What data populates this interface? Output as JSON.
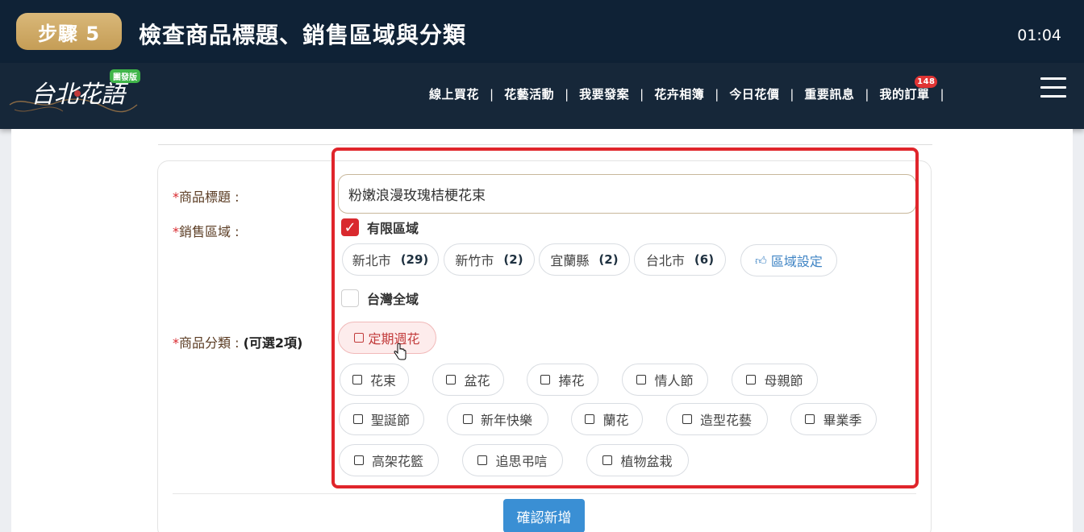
{
  "step": {
    "badge": "步驟 5",
    "title": "檢查商品標題、銷售區域與分類",
    "timer": "01:04"
  },
  "site": {
    "logo_text": "台北花語",
    "logo_badge": "團發版",
    "nav": [
      "線上買花",
      "花藝活動",
      "我要發案",
      "花卉相簿",
      "今日花價",
      "重要訊息",
      "我的訂單"
    ],
    "order_count": "148",
    "sep": "|"
  },
  "form": {
    "title_label": "商品標題 :",
    "region_label": "銷售區域 :",
    "category_label": "商品分類 :",
    "category_hint": "(可選2項)",
    "required_mark": "*",
    "title_value": "粉嫩浪漫玫瑰桔梗花束",
    "limited_region": "有限區域",
    "check_mark": "✓",
    "all_taiwan": "台灣全域",
    "regions": [
      {
        "name": "新北市",
        "count": "(29)"
      },
      {
        "name": "新竹市",
        "count": "(2)"
      },
      {
        "name": "宜蘭縣",
        "count": "(2)"
      },
      {
        "name": "台北市",
        "count": "(6)"
      }
    ],
    "region_settings": "區域設定",
    "selected_category": "定期週花",
    "categories": [
      "花束",
      "盆花",
      "捧花",
      "情人節",
      "母親節",
      "聖誕節",
      "新年快樂",
      "蘭花",
      "造型花藝",
      "畢業季",
      "高架花籃",
      "追思弔唁",
      "植物盆栽"
    ],
    "confirm_button": "確認新增"
  },
  "colors": {
    "accent_red": "#e0252b",
    "header_bg": "#0f2236",
    "badge_gold": "#c59d56",
    "confirm_blue": "#3a8fd4"
  }
}
